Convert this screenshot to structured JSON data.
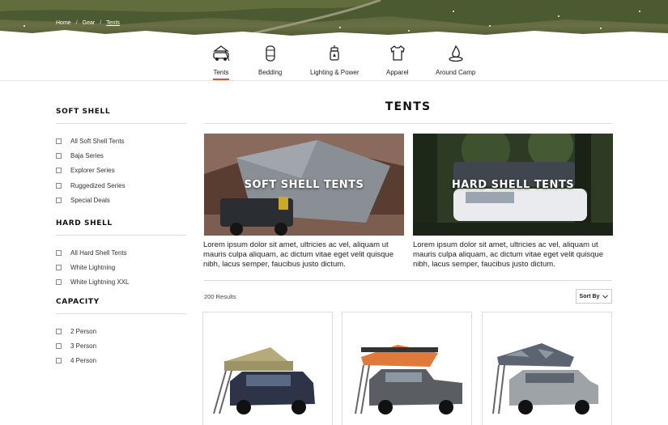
{
  "breadcrumb": {
    "items": [
      "Home",
      "Gear",
      "Tents"
    ]
  },
  "categories": [
    {
      "label": "Tents",
      "icon": "tent-icon",
      "active": true
    },
    {
      "label": "Bedding",
      "icon": "sleeping-bag-icon",
      "active": false
    },
    {
      "label": "Lighting & Power",
      "icon": "lantern-icon",
      "active": false
    },
    {
      "label": "Apparel",
      "icon": "tshirt-icon",
      "active": false
    },
    {
      "label": "Around Camp",
      "icon": "campfire-icon",
      "active": false
    }
  ],
  "filters": [
    {
      "title": "Soft Shell",
      "items": [
        "All Soft Shell Tents",
        "Baja Series",
        "Explorer Series",
        "Ruggedized Series",
        "Special Deals"
      ]
    },
    {
      "title": "Hard Shell",
      "items": [
        "All Hard Shell Tents",
        "White Lightning",
        "White Lightning XXL"
      ]
    },
    {
      "title": "Capacity",
      "items": [
        "2 Person",
        "3 Person",
        "4 Person"
      ]
    }
  ],
  "main": {
    "title": "TENTS",
    "features": [
      {
        "title": "SOFT SHELL TENTS",
        "description": "Lorem ipsum dolor sit amet, ultricies ac vel, aliquam ut mauris culpa aliquam, ac dictum vitae eget velit quisque nibh, lacus semper, faucibus justo dictum."
      },
      {
        "title": "HARD SHELL TENTS",
        "description": "Lorem ipsum dolor sit amet, ultricies ac vel, aliquam ut mauris culpa aliquam, ac dictum vitae eget velit quisque nibh, lacus semper, faucibus justo dictum."
      }
    ],
    "results": "200 Results",
    "sort_label": "Sort By"
  },
  "colors": {
    "accent": "#d8542c",
    "tent_green": "#b5ab7a",
    "tent_orange": "#e07a3c",
    "tent_camo": "#5b6470"
  }
}
